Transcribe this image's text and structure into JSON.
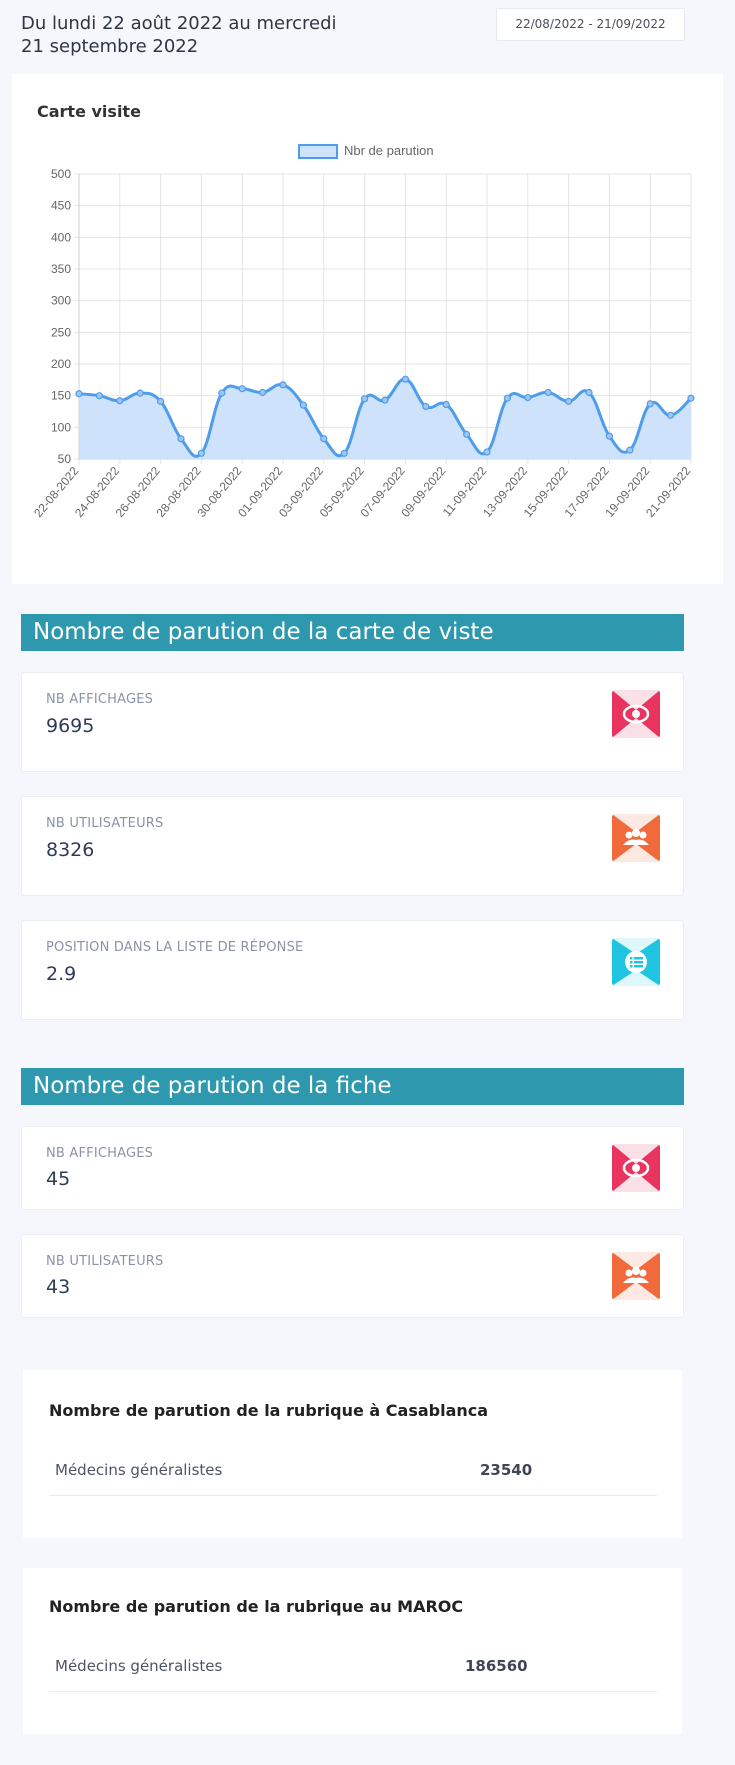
{
  "header": {
    "period_text": "Du lundi 22 août 2022 au mercredi 21 septembre 2022",
    "date_range": "22/08/2022 - 21/09/2022"
  },
  "chart_card": {
    "title": "Carte visite",
    "legend": "Nbr de parution"
  },
  "chart_data": {
    "type": "area",
    "title": "Carte visite",
    "series": [
      {
        "name": "Nbr de parution",
        "color": "#4e9deb",
        "fill": "#cfe2fb",
        "values": [
          153,
          150,
          142,
          154,
          141,
          82,
          59,
          154,
          161,
          155,
          167,
          135,
          82,
          59,
          145,
          143,
          176,
          133,
          136,
          89,
          61,
          146,
          147,
          155,
          141,
          155,
          86,
          64,
          137,
          119,
          146
        ]
      }
    ],
    "x": [
      "22-08-2022",
      "23-08-2022",
      "24-08-2022",
      "25-08-2022",
      "26-08-2022",
      "27-08-2022",
      "28-08-2022",
      "29-08-2022",
      "30-08-2022",
      "31-08-2022",
      "01-09-2022",
      "02-09-2022",
      "03-09-2022",
      "04-09-2022",
      "05-09-2022",
      "06-09-2022",
      "07-09-2022",
      "08-09-2022",
      "09-09-2022",
      "10-09-2022",
      "11-09-2022",
      "12-09-2022",
      "13-09-2022",
      "14-09-2022",
      "15-09-2022",
      "16-09-2022",
      "17-09-2022",
      "18-09-2022",
      "19-09-2022",
      "20-09-2022",
      "21-09-2022"
    ],
    "x_tick_labels": [
      "22-08-2022",
      "24-08-2022",
      "26-08-2022",
      "28-08-2022",
      "30-08-2022",
      "01-09-2022",
      "03-09-2022",
      "05-09-2022",
      "07-09-2022",
      "09-09-2022",
      "11-09-2022",
      "13-09-2022",
      "15-09-2022",
      "17-09-2022",
      "19-09-2022",
      "21-09-2022"
    ],
    "y_ticks": [
      50,
      100,
      150,
      200,
      250,
      300,
      350,
      400,
      450,
      500
    ],
    "ylim": [
      50,
      500
    ],
    "grid": true,
    "legend_position": "top"
  },
  "section_carte": {
    "title": "Nombre de parution de la carte de viste",
    "stats": [
      {
        "label": "NB AFFICHAGES",
        "value": "9695",
        "icon": "eye-icon",
        "color": "#e8345f"
      },
      {
        "label": "NB UTILISATEURS",
        "value": "8326",
        "icon": "users-icon",
        "color": "#f06a3c"
      },
      {
        "label": "POSITION DANS LA LISTE DE RÉPONSE",
        "value": "2.9",
        "icon": "list-icon",
        "color": "#1fc5e0"
      }
    ]
  },
  "section_fiche": {
    "title": "Nombre de parution de la fiche",
    "stats": [
      {
        "label": "NB AFFICHAGES",
        "value": "45",
        "icon": "eye-icon",
        "color": "#e8345f"
      },
      {
        "label": "NB UTILISATEURS",
        "value": "43",
        "icon": "users-icon",
        "color": "#f06a3c"
      }
    ]
  },
  "rubrique_casablanca": {
    "title": "Nombre de parution de la rubrique à Casablanca",
    "item": "Médecins généralistes",
    "value": "23540"
  },
  "rubrique_maroc": {
    "title": "Nombre de parution de la rubrique au MAROC",
    "item": "Médecins généralistes",
    "value": "186560"
  }
}
